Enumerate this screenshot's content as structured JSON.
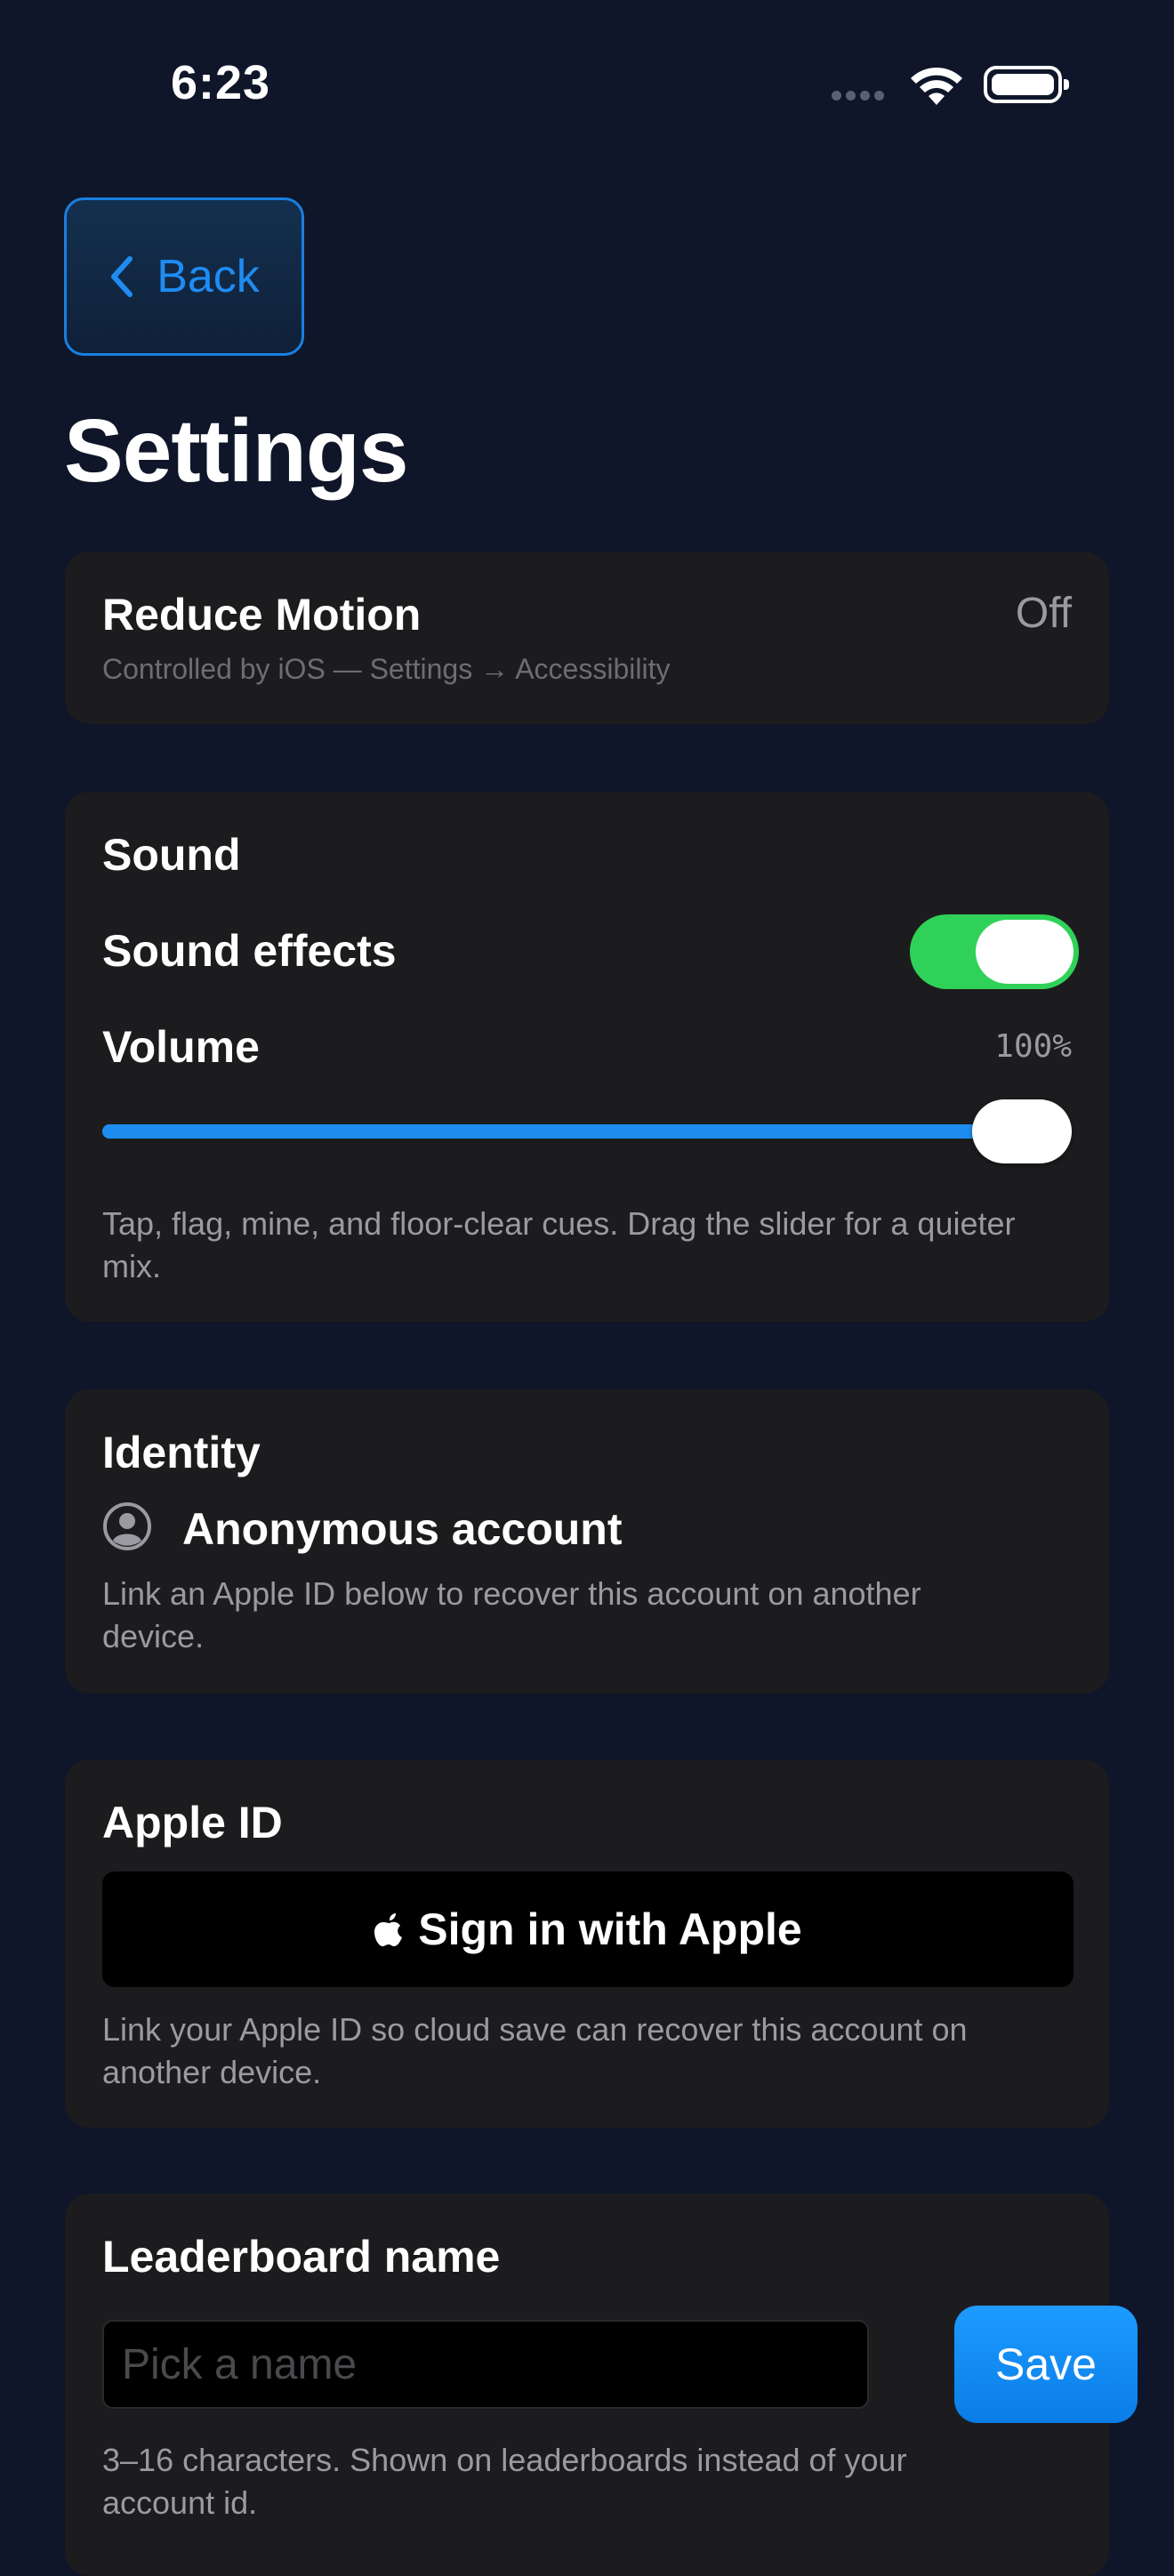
{
  "status_bar": {
    "time": "6:23"
  },
  "header": {
    "back_label": "Back",
    "title": "Settings"
  },
  "reduce_motion": {
    "title": "Reduce Motion",
    "value": "Off",
    "subtitle": "Controlled by iOS — Settings → Accessibility"
  },
  "sound": {
    "section_title": "Sound",
    "effects_label": "Sound effects",
    "effects_on": true,
    "volume_label": "Volume",
    "volume_value": "100%",
    "volume_fraction": 1.0,
    "description": "Tap, flag, mine, and floor-clear cues. Drag the slider for a quieter mix."
  },
  "identity": {
    "section_title": "Identity",
    "account_icon": "person-circle-icon",
    "account_label": "Anonymous account",
    "description": "Link an Apple ID below to recover this account on another device."
  },
  "apple_id": {
    "section_title": "Apple ID",
    "button_icon": "apple-logo-icon",
    "button_label": "Sign in with Apple",
    "description": "Link your Apple ID so cloud save can recover this account on another device."
  },
  "leaderboard": {
    "section_title": "Leaderboard name",
    "input_value": "",
    "input_placeholder": "Pick a name",
    "save_label": "Save",
    "description": "3–16 characters. Shown on leaderboards instead of your account id."
  },
  "colors": {
    "background": "#0f1629",
    "card": "#1c1c1e",
    "accent": "#1f8cf2",
    "toggle_on": "#30d158"
  }
}
